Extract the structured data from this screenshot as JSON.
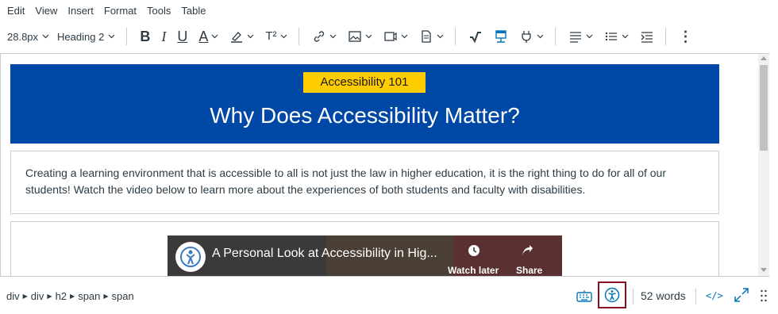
{
  "menubar": {
    "items": [
      "Edit",
      "View",
      "Insert",
      "Format",
      "Tools",
      "Table"
    ]
  },
  "toolbar": {
    "font_size": "28.8px",
    "block_format": "Heading 2",
    "bold_label": "B",
    "italic_label": "I",
    "underline_label": "U",
    "font_color_label": "A",
    "superscript_label": "T²",
    "align_label": "≡",
    "more_label": "⋮"
  },
  "content": {
    "badge": "Accessibility 101",
    "heading": "Why Does Accessibility Matter?",
    "paragraph": "Creating a learning environment that is accessible to all is not just the law in higher education, it is the right thing to do for all of our students! Watch the video below to learn more about the experiences of both students and faculty with disabilities.",
    "video_title": "A Personal Look at Accessibility in Hig...",
    "video_watch_later": "Watch later",
    "video_share": "Share"
  },
  "statusbar": {
    "path": [
      "div",
      "div",
      "h2",
      "span",
      "span"
    ],
    "word_count": "52 words",
    "html_toggle": "</>"
  },
  "colors": {
    "banner": "#0048a5",
    "badge": "#ffcc00",
    "accent": "#0374b5",
    "highlight_border": "#8b0f22"
  }
}
